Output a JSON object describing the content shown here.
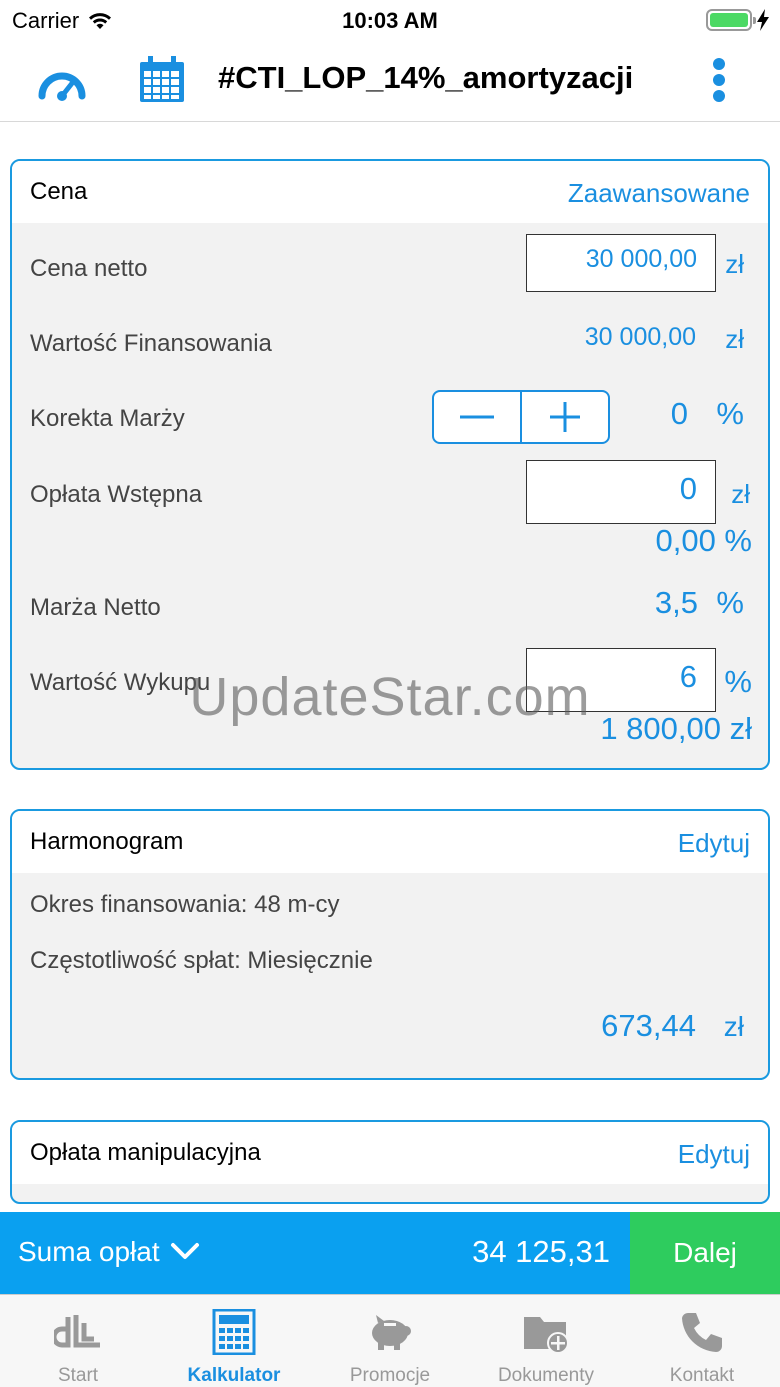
{
  "status": {
    "carrier": "Carrier",
    "time": "10:03 AM"
  },
  "nav": {
    "title": "#CTI_LOP_14%_amortyzacji"
  },
  "cena": {
    "title": "Cena",
    "action": "Zaawansowane",
    "cena_netto": {
      "label": "Cena netto",
      "value": "30 000,00",
      "unit": "zł"
    },
    "wartosc_finansowania": {
      "label": "Wartość Finansowania",
      "value": "30 000,00",
      "unit": "zł"
    },
    "korekta_marzy": {
      "label": "Korekta Marży",
      "value": "0",
      "unit": "%"
    },
    "oplata_wstepna": {
      "label": "Opłata Wstępna",
      "value": "0",
      "unit": "zł",
      "percent": "0,00 %"
    },
    "marza_netto": {
      "label": "Marża Netto",
      "value": "3,5",
      "unit": "%"
    },
    "wartosc_wykupu": {
      "label": "Wartość Wykupu",
      "value": "6",
      "unit": "%",
      "amount": "1 800,00 zł"
    }
  },
  "watermark": "UpdateStar.com",
  "harmonogram": {
    "title": "Harmonogram",
    "action": "Edytuj",
    "okres": "Okres finansowania: 48 m-cy",
    "czestotliwosc": "Częstotliwość spłat: Miesięcznie",
    "rata": "673,44",
    "unit": "zł"
  },
  "oplata_manipulacyjna": {
    "title": "Opłata manipulacyjna",
    "action": "Edytuj"
  },
  "summary": {
    "label": "Suma opłat",
    "value": "34 125,31",
    "next": "Dalej"
  },
  "tabs": [
    {
      "label": "Start"
    },
    {
      "label": "Kalkulator"
    },
    {
      "label": "Promocje"
    },
    {
      "label": "Dokumenty"
    },
    {
      "label": "Kontakt"
    }
  ],
  "colors": {
    "accent": "#1a8fe0",
    "summary": "#0aa0f0",
    "next": "#2ecc5e"
  }
}
